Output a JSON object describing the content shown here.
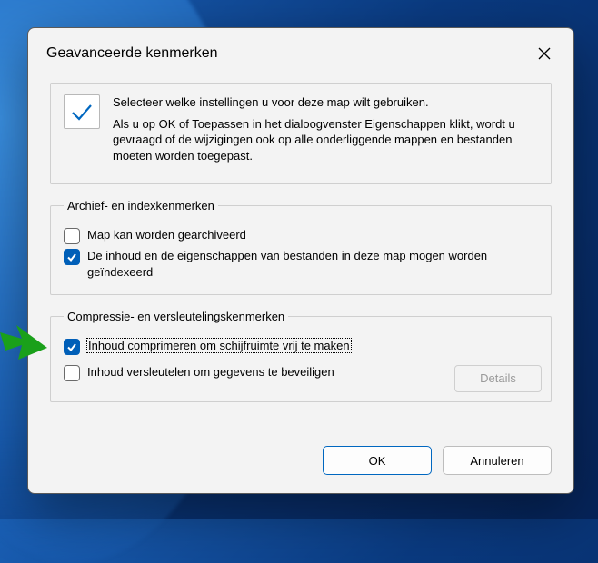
{
  "dialog": {
    "title": "Geavanceerde kenmerken",
    "intro": {
      "line1": "Selecteer welke instellingen u voor deze map wilt gebruiken.",
      "line2": "Als u op OK of Toepassen in het dialoogvenster Eigenschappen klikt, wordt u gevraagd of de wijzigingen ook op alle onderliggende mappen en bestanden moeten worden toegepast."
    },
    "group_archive": {
      "legend": "Archief- en indexkenmerken",
      "archive_label": "Map kan worden gearchiveerd",
      "archive_checked": false,
      "index_label": "De inhoud en de eigenschappen van bestanden in deze map mogen worden geïndexeerd",
      "index_checked": true
    },
    "group_compress": {
      "legend": "Compressie- en versleutelingskenmerken",
      "compress_label": "Inhoud comprimeren om schijfruimte vrij te maken",
      "compress_checked": true,
      "encrypt_label": "Inhoud versleutelen om gegevens te beveiligen",
      "encrypt_checked": false,
      "details_label": "Details"
    },
    "buttons": {
      "ok": "OK",
      "cancel": "Annuleren"
    }
  }
}
